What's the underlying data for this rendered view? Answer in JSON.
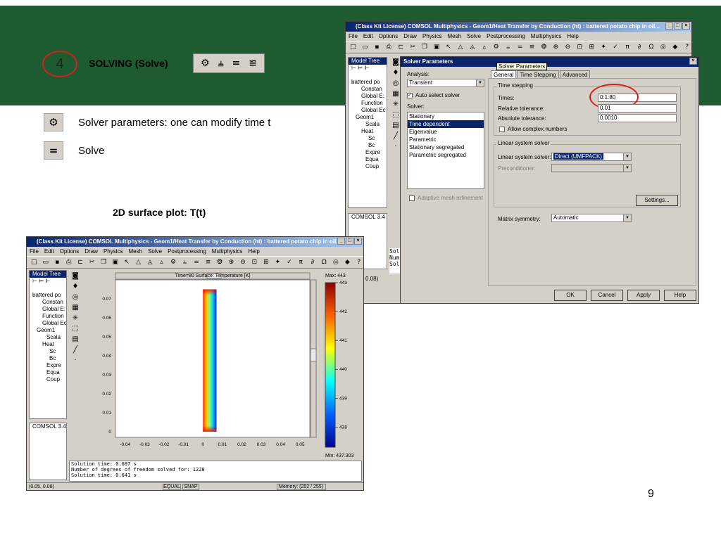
{
  "slide": {
    "step_number": "4",
    "step_title": "SOLVING (Solve)",
    "bullets": [
      {
        "icon": "solver-parameters-icon",
        "text": "Solver parameters: one can modify time t"
      },
      {
        "icon": "solve-icon",
        "text": "Solve"
      }
    ],
    "caption": "2D surface plot: T(t)",
    "page_number": "9",
    "toolstrip_glyphs": [
      "⚙",
      "⫨",
      "=",
      "≌"
    ]
  },
  "top_window": {
    "title": "(Class Kit License) COMSOL Multiphysics - Geom1/Heat Transfer by Conduction (ht) : battered potato chip in oil...",
    "menu": [
      "File",
      "Edit",
      "Options",
      "Draw",
      "Physics",
      "Mesh",
      "Solve",
      "Postprocessing",
      "Multiphysics",
      "Help"
    ],
    "model_tree_label": "Model Tree",
    "tree": [
      "battered po",
      "Constan",
      "Global E:",
      "Function",
      "Global Ec",
      "Geom1",
      "Scala",
      "Heat",
      "Sc",
      "Bc",
      "Expre",
      "Equa",
      "Coup"
    ],
    "version": "COMSOL 3.4",
    "log_lines": [
      "Sol",
      "Num",
      "Sol"
    ],
    "coord": "0.08)"
  },
  "dialog": {
    "title": "Solver Parameters",
    "tooltip": "Solver Parameters",
    "analysis_label": "Analysis:",
    "analysis_value": "Transient",
    "auto_select_label": "Auto select solver",
    "solver_label": "Solver:",
    "solvers": [
      "Stationary",
      "Time dependent",
      "Eigenvalue",
      "Parametric",
      "Stationary segregated",
      "Parametric segregated"
    ],
    "selected_solver": "Time dependent",
    "adaptive_label": "Adaptive mesh refinement",
    "tabs": [
      "General",
      "Time Stepping",
      "Advanced"
    ],
    "time_stepping_group": "Time stepping",
    "times_label": "Times:",
    "times_value": "0:1:80",
    "rel_tol_label": "Relative tolerance:",
    "rel_tol_value": "0.01",
    "abs_tol_label": "Absolute tolerance:",
    "abs_tol_value": "0.0010",
    "complex_label": "Allow complex numbers",
    "linear_group": "Linear system solver",
    "linear_label": "Linear system solver:",
    "linear_value": "Direct (UMFPACK)",
    "precond_label": "Preconditioner:",
    "settings_button": "Settings...",
    "matrix_label": "Matrix symmetry:",
    "matrix_value": "Automatic",
    "buttons": [
      "OK",
      "Cancel",
      "Apply",
      "Help"
    ]
  },
  "bottom_window": {
    "title": "(Class Kit License) COMSOL Multiphysics - Geom1/Heat Transfer by Conduction (ht) : battered potato chip in oil...",
    "menu": [
      "File",
      "Edit",
      "Options",
      "Draw",
      "Physics",
      "Mesh",
      "Solve",
      "Postprocessing",
      "Multiphysics",
      "Help"
    ],
    "model_tree_label": "Model Tree",
    "tree": [
      "battered po",
      "Constan",
      "Global E:",
      "Function",
      "Global Ec",
      "Geom1",
      "Scala",
      "Heat",
      "Sc",
      "Bc",
      "Expre",
      "Equa",
      "Coup"
    ],
    "version": "COMSOL 3.4",
    "plot_title": "Time=80    Surface: Temperature [K]",
    "max_label": "Max: 443",
    "min_label": "Min: 437.303",
    "log_lines": [
      "Solution time: 0.687 s",
      "Number of degrees of freedom solved for: 1228",
      "Solution time: 0.641 s"
    ],
    "status": [
      "(0.05, 0.08)",
      "EQUAL",
      "SNAP",
      "Memory: (252 / 255)"
    ]
  },
  "chart_data": {
    "type": "heatmap",
    "title": "Time=80    Surface: Temperature [K]",
    "x_ticks": [
      "-0.04",
      "-0.03",
      "-0.02",
      "-0.01",
      "0",
      "0.01",
      "0.02",
      "0.03",
      "0.04",
      "0.05"
    ],
    "y_ticks": [
      "0",
      "0.01",
      "0.02",
      "0.03",
      "0.04",
      "0.05",
      "0.06",
      "0.07"
    ],
    "colorbar_ticks": [
      "443",
      "442",
      "441",
      "440",
      "439",
      "438"
    ],
    "colorbar_range": [
      437.303,
      443
    ],
    "xlim": [
      -0.045,
      0.055
    ],
    "ylim": [
      -0.003,
      0.08
    ],
    "domain_x": [
      0,
      0.007
    ],
    "domain_y": [
      0,
      0.075
    ]
  }
}
